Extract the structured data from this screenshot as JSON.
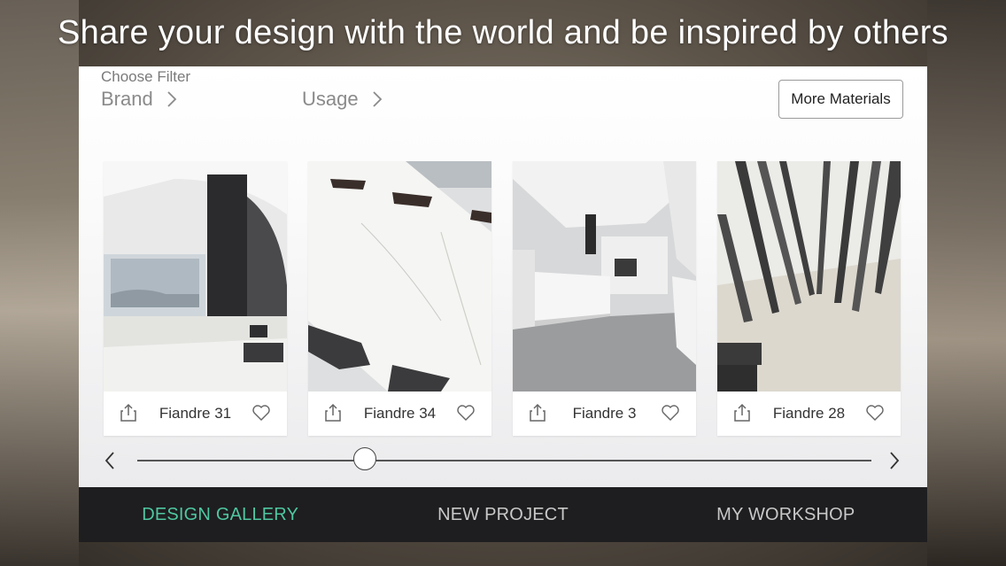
{
  "headline": "Share your design with the world and be inspired by others",
  "filters": {
    "label": "Choose Filter",
    "brand": "Brand",
    "usage": "Usage"
  },
  "more_materials": "More Materials",
  "cards": [
    {
      "name": "Fiandre 31"
    },
    {
      "name": "Fiandre 34"
    },
    {
      "name": "Fiandre 3"
    },
    {
      "name": "Fiandre 28"
    }
  ],
  "slider": {
    "position": 0.31
  },
  "nav": {
    "design_gallery": "DESIGN GALLERY",
    "new_project": "NEW PROJECT",
    "my_workshop": "MY WORKSHOP"
  },
  "colors": {
    "accent": "#4fc7a0",
    "nav_bg": "#1e1e20"
  }
}
